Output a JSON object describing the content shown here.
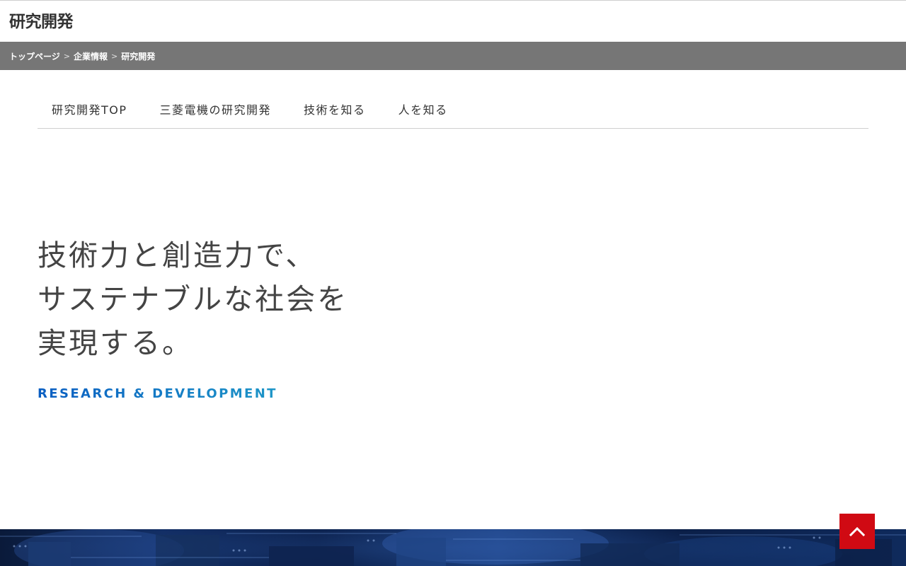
{
  "header": {
    "title": "研究開発"
  },
  "breadcrumb": {
    "items": [
      {
        "label": "トップページ"
      },
      {
        "label": "企業情報"
      },
      {
        "label": "研究開発"
      }
    ],
    "separator": ">"
  },
  "sub_nav": {
    "items": [
      {
        "label": "研究開発TOP"
      },
      {
        "label": "三菱電機の研究開発"
      },
      {
        "label": "技術を知る"
      },
      {
        "label": "人を知る"
      }
    ]
  },
  "hero": {
    "headline_lines": [
      "技術力と創造力で、",
      "サステナブルな社会を",
      "実現する。"
    ],
    "tagline": "RESEARCH & DEVELOPMENT"
  },
  "back_to_top": {
    "icon": "chevron-up-icon"
  },
  "colors": {
    "breadcrumb_bg": "#767676",
    "back_to_top_bg": "#d00a13",
    "tagline_start": "#0a5ec2",
    "tagline_end": "#23a6c9",
    "banner_dark": "#0a1a3a"
  }
}
